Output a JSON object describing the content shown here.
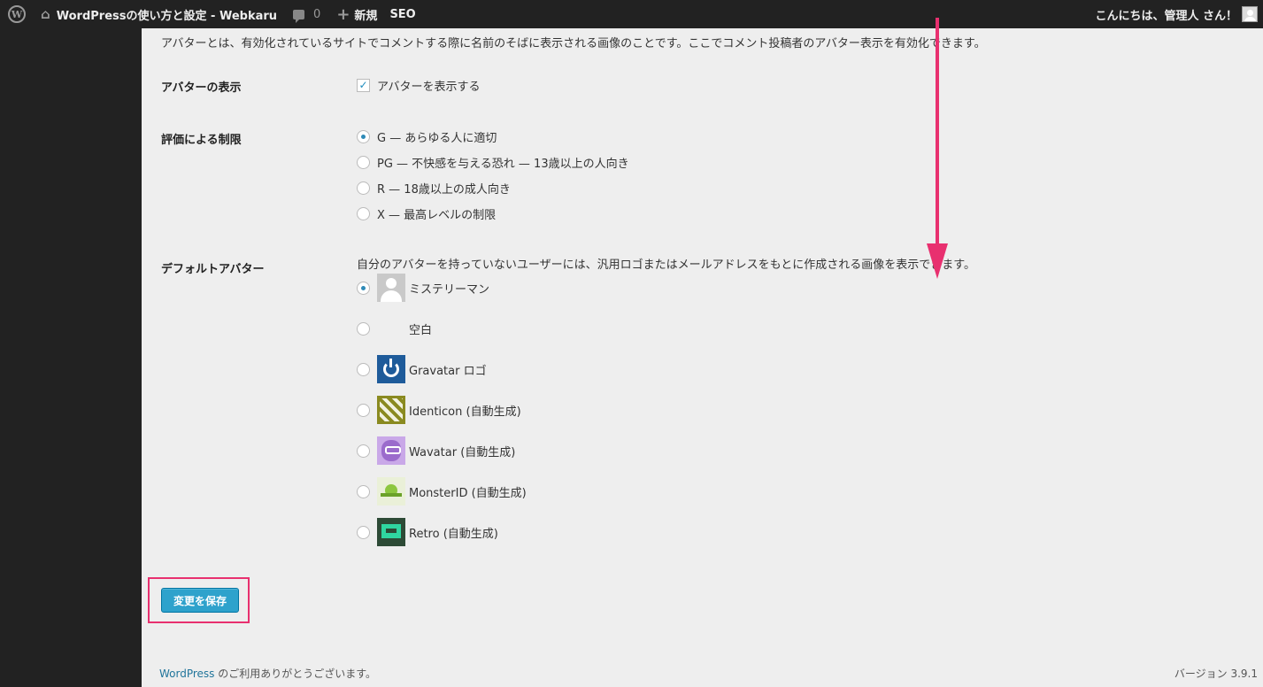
{
  "adminbar": {
    "site_name": "WordPressの使い方と設定 - Webkaru",
    "comments_count": "0",
    "new_label": "新規",
    "seo_label": "SEO",
    "howdy": "こんにちは、管理人 さん！"
  },
  "intro_text": "アバターとは、有効化されているサイトでコメントする際に名前のそばに表示される画像のことです。ここでコメント投稿者のアバター表示を有効化できます。",
  "show_avatars": {
    "label": "アバターの表示",
    "checkbox_label": "アバターを表示する",
    "checked": true
  },
  "rating": {
    "label": "評価による制限",
    "options": [
      {
        "label": "G — あらゆる人に適切",
        "selected": true
      },
      {
        "label": "PG — 不快感を与える恐れ — 13歳以上の人向き",
        "selected": false
      },
      {
        "label": "R — 18歳以上の成人向き",
        "selected": false
      },
      {
        "label": "X — 最高レベルの制限",
        "selected": false
      }
    ]
  },
  "default_avatar": {
    "label": "デフォルトアバター",
    "description": "自分のアバターを持っていないユーザーには、汎用ロゴまたはメールアドレスをもとに作成される画像を表示できます。",
    "options": [
      {
        "label": "ミステリーマン",
        "icon": "mystery-man-avatar-icon",
        "selected": true
      },
      {
        "label": "空白",
        "icon": "blank-avatar-icon",
        "selected": false
      },
      {
        "label": "Gravatar ロゴ",
        "icon": "gravatar-logo-icon",
        "selected": false
      },
      {
        "label": "Identicon (自動生成)",
        "icon": "identicon-avatar-icon",
        "selected": false
      },
      {
        "label": "Wavatar (自動生成)",
        "icon": "wavatar-avatar-icon",
        "selected": false
      },
      {
        "label": "MonsterID (自動生成)",
        "icon": "monsterid-avatar-icon",
        "selected": false
      },
      {
        "label": "Retro (自動生成)",
        "icon": "retro-avatar-icon",
        "selected": false
      }
    ]
  },
  "save_button": "変更を保存",
  "footer": {
    "link": "WordPress",
    "thanks": " のご利用ありがとうございます。",
    "version": "バージョン 3.9.1"
  },
  "colors": {
    "adminbar_bg": "#222222",
    "content_bg": "#eeeeee",
    "button_bg": "#2ea2cc",
    "annotation": "#e8306f"
  }
}
